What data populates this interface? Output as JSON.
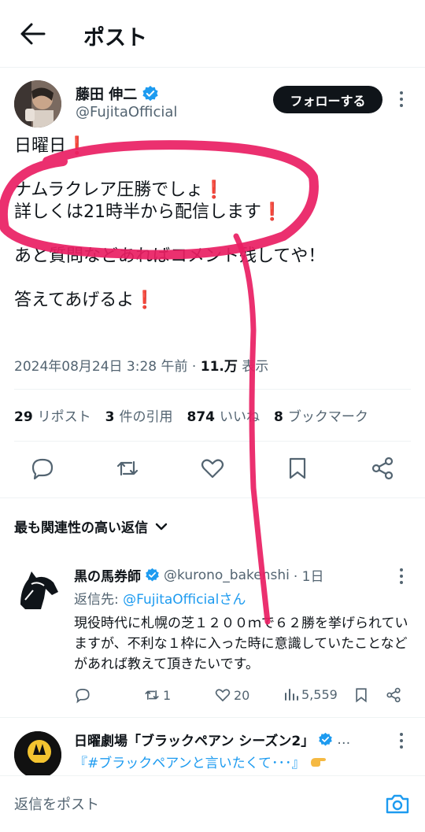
{
  "header": {
    "title": "ポスト"
  },
  "author": {
    "name": "藤田 伸二",
    "handle": "@FujitaOfficial",
    "follow_label": "フォローする"
  },
  "tweet": {
    "line1": "日曜日",
    "line2": "ナムラクレア圧勝でしょ",
    "line3": "詳しくは21時半から配信します",
    "line4": "あと質問などあればコメント残してや！",
    "line5": "答えてあげるよ",
    "exclamation": "❗"
  },
  "meta": {
    "date": "2024年08月24日 3:28 午前",
    "separator": "·",
    "views": "11.万",
    "views_label": "表示"
  },
  "stats": {
    "reposts_count": "29",
    "reposts_label": "リポスト",
    "quotes_count": "3",
    "quotes_label": "件の引用",
    "likes_count": "874",
    "likes_label": "いいね",
    "bookmarks_count": "8",
    "bookmarks_label": "ブックマーク"
  },
  "sort": {
    "label": "最も関連性の高い返信"
  },
  "reply1": {
    "name": "黒の馬券師",
    "handle": "@kurono_bakenshi",
    "time": "· 1日",
    "replyto_prefix": "返信先: ",
    "replyto_link": "@FujitaOfficialさん",
    "text": "現役時代に札幌の芝１２００ｍで６２勝を挙げられていますが、不利な１枠に入った時に意識していたことなどがあれば教えて頂きたいです。",
    "reposts": "1",
    "likes": "20",
    "views": "5,559"
  },
  "reply2": {
    "name": "日曜劇場「ブラックペアン シーズン2」",
    "ellipsis": "…",
    "text": "『#ブラックペアンと言いたくて･･･』"
  },
  "compose": {
    "placeholder": "返信をポスト"
  },
  "colors": {
    "accent": "#1d9bf0",
    "annotation": "#e91e63",
    "text": "#0f1419",
    "muted": "#536471"
  }
}
